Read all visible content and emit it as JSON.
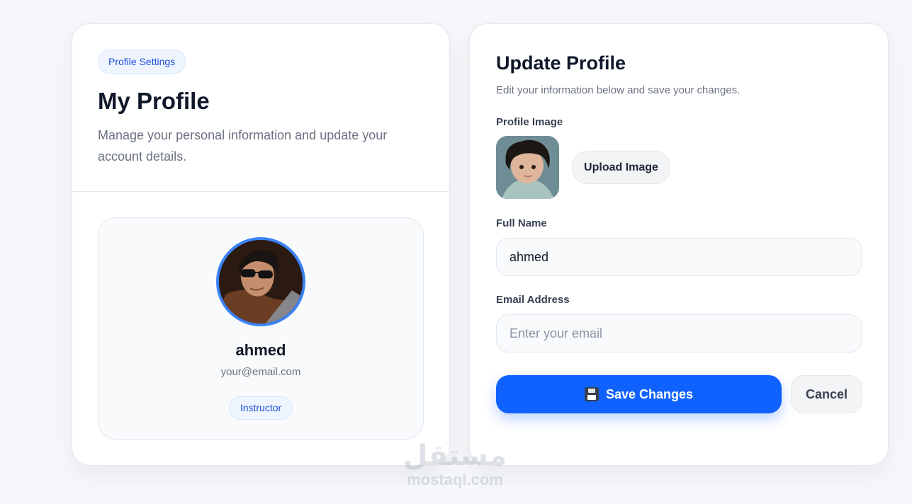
{
  "summary": {
    "pill_label": "Profile Settings",
    "title": "My Profile",
    "description": "Manage your personal information and update your account details.",
    "name": "ahmed",
    "email": "your@email.com",
    "role": "Instructor"
  },
  "form": {
    "title": "Update Profile",
    "subtitle": "Edit your information below and save your changes.",
    "profile_image_label": "Profile Image",
    "upload_label": "Upload Image",
    "full_name_label": "Full Name",
    "full_name_value": "ahmed",
    "email_label": "Email Address",
    "email_value": "",
    "email_placeholder": "Enter your email",
    "save_icon": "floppy-disk-icon",
    "save_label": "Save Changes",
    "cancel_label": "Cancel"
  },
  "colors": {
    "primary": "#1062ff",
    "badge_bg": "#eff5ff",
    "avatar_ring": "#3b82f6"
  },
  "watermark": {
    "arabic": "مستقل",
    "latin": "mostaql.com"
  }
}
